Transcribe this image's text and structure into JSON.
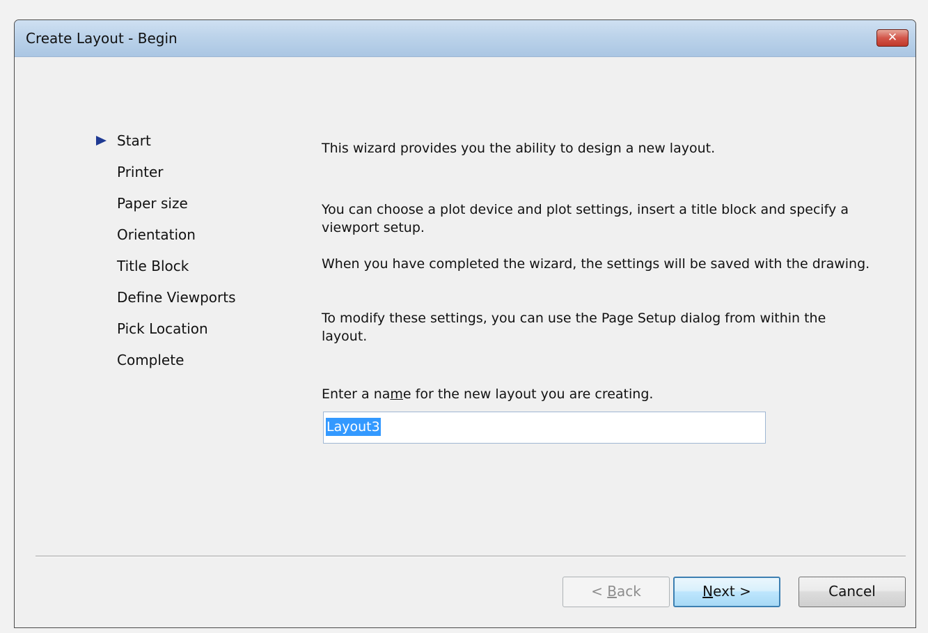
{
  "window": {
    "title": "Create Layout - Begin",
    "close_label": "✕"
  },
  "steps": [
    {
      "label": "Start",
      "current": true
    },
    {
      "label": "Printer",
      "current": false
    },
    {
      "label": "Paper size",
      "current": false
    },
    {
      "label": "Orientation",
      "current": false
    },
    {
      "label": "Title Block",
      "current": false
    },
    {
      "label": "Define Viewports",
      "current": false
    },
    {
      "label": "Pick Location",
      "current": false
    },
    {
      "label": "Complete",
      "current": false
    }
  ],
  "content": {
    "intro": "This wizard provides you the ability to design a new layout.",
    "paragraph2": "You can choose a plot device and plot settings, insert a title block and specify a viewport setup.",
    "paragraph3": "When you have completed the wizard, the settings will be saved with the drawing.",
    "paragraph4": "To modify these settings, you can use the Page Setup dialog from within the layout.",
    "name_label_pre": "Enter a na",
    "name_label_key": "m",
    "name_label_post": "e for the new layout you are creating.",
    "name_value": "Layout3"
  },
  "buttons": {
    "back_pre": "< ",
    "back_key": "B",
    "back_post": "ack",
    "next_key": "N",
    "next_post": "ext >",
    "cancel": "Cancel"
  },
  "colors": {
    "step_arrow": "#1f3a93",
    "selection_highlight": "#3399ff",
    "default_button_border": "#3c7fb1"
  },
  "icons": {
    "current_step": "triangle-right-icon",
    "close": "close-icon"
  }
}
